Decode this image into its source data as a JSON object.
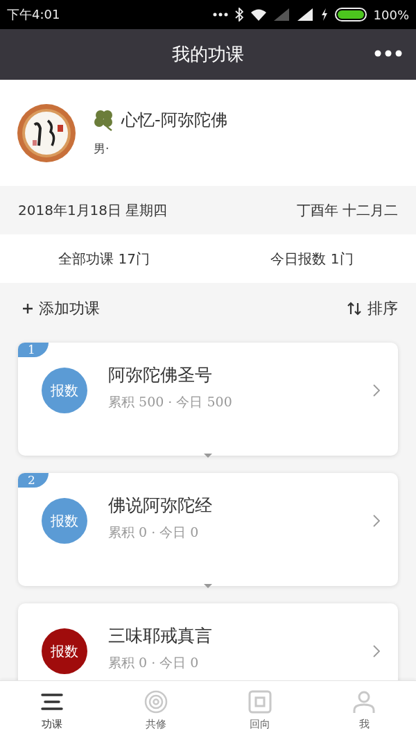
{
  "status_bar": {
    "time": "下午4:01",
    "battery": "100%"
  },
  "header": {
    "title": "我的功课"
  },
  "profile": {
    "name": "心忆-阿弥陀佛",
    "gender": "男·"
  },
  "date_row": {
    "solar": "2018年1月18日 星期四",
    "lunar": "丁酉年 十二月二"
  },
  "summary": {
    "total": "全部功课 17门",
    "today": "今日报数 1门"
  },
  "actions": {
    "add": "添加功课",
    "sort": "排序"
  },
  "courses": [
    {
      "index": "1",
      "title": "阿弥陀佛圣号",
      "stats": "累积 500 · 今日 500",
      "button": "报数",
      "color": "#5b9bd5"
    },
    {
      "index": "2",
      "title": "佛说阿弥陀经",
      "stats": "累积 0 · 今日 0",
      "button": "报数",
      "color": "#5b9bd5"
    },
    {
      "title": "三味耶戒真言",
      "stats": "累积 0 · 今日 0",
      "button": "报数",
      "color": "#a00c0c"
    }
  ],
  "tabs": [
    {
      "label": "功课",
      "selected": true
    },
    {
      "label": "共修",
      "selected": false
    },
    {
      "label": "回向",
      "selected": false
    },
    {
      "label": "我",
      "selected": false
    }
  ]
}
